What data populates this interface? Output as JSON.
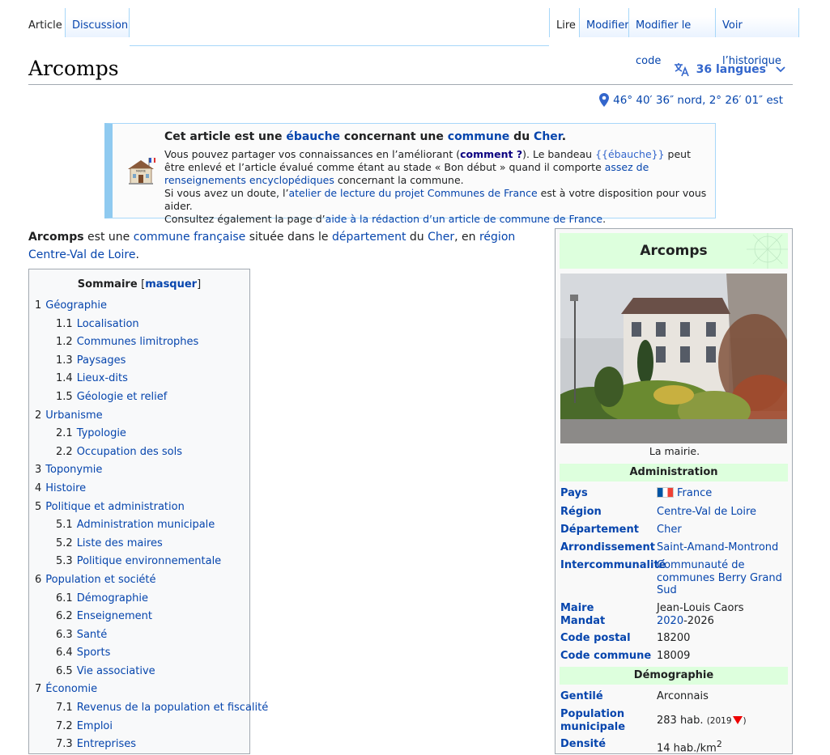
{
  "tabs": {
    "article": "Article",
    "discussion": "Discussion",
    "read": "Lire",
    "edit": "Modifier",
    "edit_source": "Modifier le code",
    "history": "Voir l’historique"
  },
  "page": {
    "title": "Arcomps",
    "languages": "36 langues",
    "coordinates": "46° 40′ 36″ nord, 2° 26′ 01″ est"
  },
  "stub": {
    "h1": "Cet article est une ",
    "h_link1": "ébauche",
    "h2": " concernant une ",
    "h_link2": "commune",
    "h3": " du ",
    "h_link3": "Cher",
    "h4": ".",
    "p1a": "Vous pouvez partager vos connaissances en l’améliorant (",
    "p1_link": "comment ?",
    "p1b": "). Le bandeau ",
    "p1_code": "{{ébauche}}",
    "p1c": " peut être enlevé et l’article évalué comme étant au stade « Bon début » quand il comporte ",
    "p1_link2": "assez de renseignements encyclopédiques",
    "p1d": " concernant la commune.",
    "p2a": "Si vous avez un doute, l’",
    "p2_link": "atelier de lecture du projet Communes de France",
    "p2b": " est à votre disposition pour vous aider.",
    "p3a": "Consultez également la page d’",
    "p3_link": "aide à la rédaction d’un article de commune de France",
    "p3b": "."
  },
  "lead": {
    "bold": "Arcomps",
    "t1": " est une ",
    "l1": "commune française",
    "t2": " située dans le ",
    "l2": "département",
    "t3": " du ",
    "l3": "Cher",
    "t4": ", en ",
    "l4": "région Centre-Val de Loire",
    "t5": "."
  },
  "toc": {
    "title": "Sommaire",
    "toggle_open": "[",
    "toggle": "masquer",
    "toggle_close": "]",
    "items": [
      {
        "num": "1",
        "label": "Géographie",
        "level": 1
      },
      {
        "num": "1.1",
        "label": "Localisation",
        "level": 2
      },
      {
        "num": "1.2",
        "label": "Communes limitrophes",
        "level": 2
      },
      {
        "num": "1.3",
        "label": "Paysages",
        "level": 2
      },
      {
        "num": "1.4",
        "label": "Lieux-dits",
        "level": 2
      },
      {
        "num": "1.5",
        "label": "Géologie et relief",
        "level": 2
      },
      {
        "num": "2",
        "label": "Urbanisme",
        "level": 1
      },
      {
        "num": "2.1",
        "label": "Typologie",
        "level": 2
      },
      {
        "num": "2.2",
        "label": "Occupation des sols",
        "level": 2
      },
      {
        "num": "3",
        "label": "Toponymie",
        "level": 1
      },
      {
        "num": "4",
        "label": "Histoire",
        "level": 1
      },
      {
        "num": "5",
        "label": "Politique et administration",
        "level": 1
      },
      {
        "num": "5.1",
        "label": "Administration municipale",
        "level": 2
      },
      {
        "num": "5.2",
        "label": "Liste des maires",
        "level": 2
      },
      {
        "num": "5.3",
        "label": "Politique environnementale",
        "level": 2
      },
      {
        "num": "6",
        "label": "Population et société",
        "level": 1
      },
      {
        "num": "6.1",
        "label": "Démographie",
        "level": 2
      },
      {
        "num": "6.2",
        "label": "Enseignement",
        "level": 2
      },
      {
        "num": "6.3",
        "label": "Santé",
        "level": 2
      },
      {
        "num": "6.4",
        "label": "Sports",
        "level": 2
      },
      {
        "num": "6.5",
        "label": "Vie associative",
        "level": 2
      },
      {
        "num": "7",
        "label": "Économie",
        "level": 1
      },
      {
        "num": "7.1",
        "label": "Revenus de la population et fiscalité",
        "level": 2
      },
      {
        "num": "7.2",
        "label": "Emploi",
        "level": 2
      },
      {
        "num": "7.3",
        "label": "Entreprises",
        "level": 2
      }
    ]
  },
  "infobox": {
    "title": "Arcomps",
    "caption": "La mairie.",
    "sec_admin": "Administration",
    "sec_demo": "Démographie",
    "pays_k": "Pays",
    "pays_v": "France",
    "region_k": "Région",
    "region_v": "Centre-Val de Loire",
    "dept_k": "Département",
    "dept_v": "Cher",
    "arr_k": "Arrondissement",
    "arr_v": "Saint-Amand-Montrond",
    "interco_k": "Intercommunalité",
    "interco_v": "Communauté de communes Berry Grand Sud",
    "maire_k1": "Maire",
    "maire_k2": "Mandat",
    "maire_v": "Jean-Louis Caors",
    "mandat_start": "2020",
    "mandat_end": "-2026",
    "cp_k": "Code postal",
    "cp_v": "18200",
    "cc_k": "Code commune",
    "cc_v": "18009",
    "gentile_k": "Gentilé",
    "gentile_v": "Arconnais",
    "pop_k": "Population municipale",
    "pop_v": "283 hab.",
    "pop_year_open": "(",
    "pop_year": "2019",
    "pop_year_close": ")",
    "dens_k": "Densité",
    "dens_v": "14 hab./km",
    "dens_sup": "2"
  }
}
